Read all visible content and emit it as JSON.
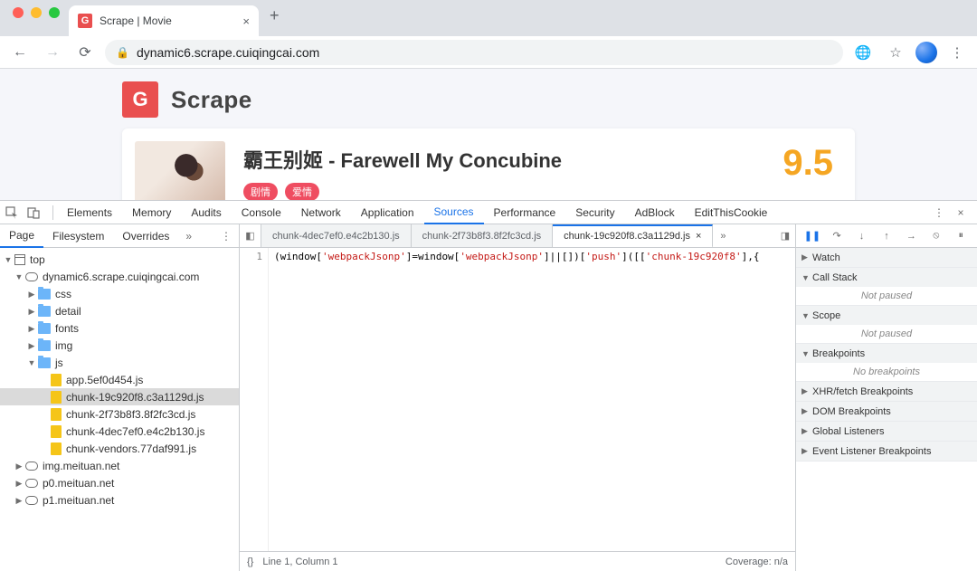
{
  "browser": {
    "tab_title": "Scrape | Movie",
    "url": "dynamic6.scrape.cuiqingcai.com",
    "favicon_letter": "G"
  },
  "page": {
    "brand": "Scrape",
    "brand_letter": "G",
    "movie_title": "霸王别姬 - Farewell My Concubine",
    "tag1": "剧情",
    "tag2": "爱情",
    "score": "9.5"
  },
  "devtools": {
    "tabs": [
      "Elements",
      "Memory",
      "Audits",
      "Console",
      "Network",
      "Application",
      "Sources",
      "Performance",
      "Security",
      "AdBlock",
      "EditThisCookie"
    ],
    "active_tab": "Sources",
    "nav_tabs": [
      "Page",
      "Filesystem",
      "Overrides"
    ],
    "tree": {
      "top": "top",
      "domain": "dynamic6.scrape.cuiqingcai.com",
      "folders": [
        "css",
        "detail",
        "fonts",
        "img",
        "js"
      ],
      "js_files": [
        "app.5ef0d454.js",
        "chunk-19c920f8.c3a1129d.js",
        "chunk-2f73b8f3.8f2fc3cd.js",
        "chunk-4dec7ef0.e4c2b130.js",
        "chunk-vendors.77daf991.js"
      ],
      "clouds": [
        "img.meituan.net",
        "p0.meituan.net",
        "p1.meituan.net"
      ]
    },
    "file_tabs": [
      "chunk-4dec7ef0.e4c2b130.js",
      "chunk-2f73b8f3.8f2fc3cd.js",
      "chunk-19c920f8.c3a1129d.js"
    ],
    "code": {
      "line_no": "1",
      "t1": "(window[",
      "s1": "'webpackJsonp'",
      "t2": "]=window[",
      "s2": "'webpackJsonp'",
      "t3": "]||[])[",
      "s3": "'push'",
      "t4": "]([[",
      "s4": "'chunk-19c920f8'",
      "t5": "],{"
    },
    "status_left": "Line 1, Column 1",
    "status_right": "Coverage: n/a",
    "debugger": {
      "sections": {
        "watch": "Watch",
        "callstack": "Call Stack",
        "scope": "Scope",
        "breakpoints": "Breakpoints",
        "xhr": "XHR/fetch Breakpoints",
        "dom": "DOM Breakpoints",
        "global": "Global Listeners",
        "event": "Event Listener Breakpoints"
      },
      "not_paused": "Not paused",
      "no_breakpoints": "No breakpoints"
    }
  }
}
